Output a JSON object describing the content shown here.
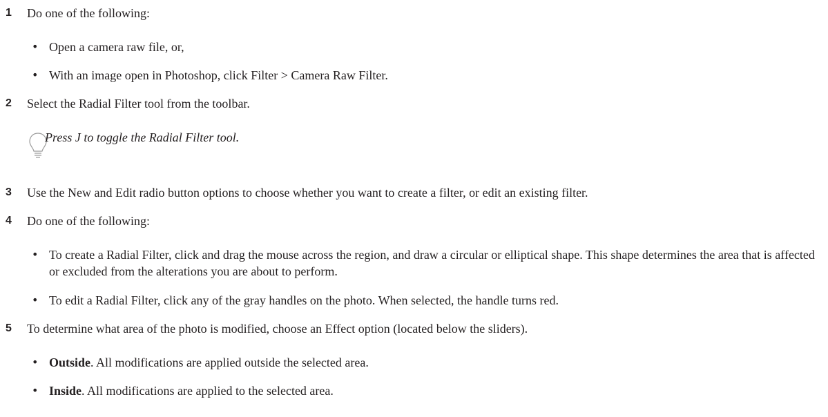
{
  "steps": [
    {
      "num": "1",
      "text": "Do one of the following:"
    },
    {
      "num": "2",
      "text": "Select the Radial Filter tool from the toolbar."
    },
    {
      "num": "3",
      "text": "Use the New and Edit radio button options to choose whether you want to create a filter, or edit an existing filter."
    },
    {
      "num": "4",
      "text": "Do one of the following:"
    },
    {
      "num": "5",
      "text": "To determine what area of the photo is modified, choose an Effect option (located below the sliders)."
    }
  ],
  "step1_bullets": [
    "Open a camera raw file, or,",
    "With an image open in Photoshop, click Filter > Camera Raw Filter."
  ],
  "tip": {
    "icon": "lightbulb-icon",
    "text": "Press J to toggle the Radial Filter tool."
  },
  "step4_bullets": [
    "To create a Radial Filter, click and drag the mouse across the region, and draw a circular or elliptical shape. This shape determines the area that is affected or excluded from the alterations you are about to perform.",
    "To edit a Radial Filter, click any of the gray handles on the photo. When selected, the handle turns red."
  ],
  "step5_bullets": [
    {
      "term": "Outside",
      "rest": ". All modifications are applied outside the selected area."
    },
    {
      "term": "Inside",
      "rest": ". All modifications are applied to the selected area."
    }
  ],
  "bullet_char": "•"
}
